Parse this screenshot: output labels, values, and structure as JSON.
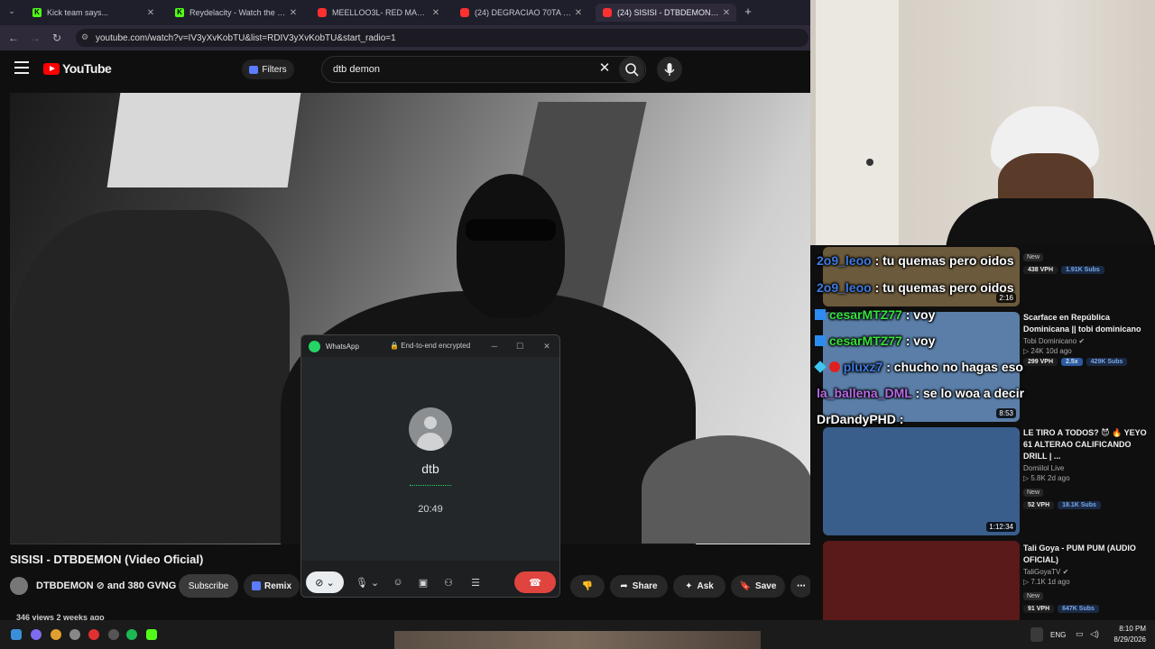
{
  "browser": {
    "tabs": [
      {
        "title": "Kick team says...",
        "favicon": "kick-icon"
      },
      {
        "title": "Reydelacity - Watch the VOD o",
        "favicon": "kick-icon"
      },
      {
        "title": "MEELLOO3L- RED MALA (VIDE",
        "favicon": "youtube-icon"
      },
      {
        "title": "(24) DEGRACIAO 70TA - YouTu",
        "favicon": "youtube-icon"
      },
      {
        "title": "(24) SISISI - DTBDEMON (Vide",
        "favicon": "youtube-icon"
      }
    ],
    "url": "youtube.com/watch?v=IV3yXvKobTU&list=RDIV3yXvKobTU&start_radio=1"
  },
  "youtube": {
    "logo": "YouTube",
    "filters_label": "Filters",
    "search_value": "dtb demon"
  },
  "video": {
    "title": "SISISI - DTBDEMON (Video Oficial)",
    "channel": "DTBDEMON ⊘ and 380 GVNG",
    "subscribe_label": "Subscribe",
    "remix_label": "Remix",
    "share_label": "Share",
    "ask_label": "Ask",
    "save_label": "Save",
    "views": "346 views  2 weeks ago"
  },
  "whatsapp": {
    "app_name": "WhatsApp",
    "encryption": "End-to-end encrypted",
    "contact": "dtb",
    "timer": "20:49"
  },
  "recommendations": [
    {
      "title": "",
      "channel": "",
      "meta": "",
      "badge": "New",
      "duration": "2:16",
      "vph": "438 VPH",
      "multiplier": "",
      "subs": "1.91K Subs",
      "thumb": "#6b5a3c"
    },
    {
      "title": "Scarface en República Dominicana || tobi dominicano",
      "channel": "Tobi Dominicano ✔",
      "meta": "▷ 24K  10d ago",
      "badge": "",
      "duration": "8:53",
      "vph": "299 VPH",
      "multiplier": "2.5x",
      "subs": "429K Subs",
      "thumb": "#5a7ea8"
    },
    {
      "title": "LE TIRO A TODOS? 😈 🔥 YEYO 61 ALTERAO CALIFICANDO DRILL | ...",
      "channel": "Domiilol Live",
      "meta": "▷ 5.8K  2d ago",
      "badge": "New",
      "duration": "1:12:34",
      "vph": "52 VPH",
      "multiplier": "",
      "subs": "18.1K Subs",
      "thumb": "#3a5e8c"
    },
    {
      "title": "Tali Goya - PUM PUM (AUDIO OFICIAL)",
      "channel": "TaliGoyaTV ✔",
      "meta": "▷ 7.1K  1d ago",
      "badge": "New",
      "duration": "",
      "vph": "91 VPH",
      "multiplier": "",
      "subs": "647K Subs",
      "thumb": "#5a1a1a"
    }
  ],
  "chat": [
    {
      "user": "2o9_leoo",
      "message": ": tu quemas pero oidos",
      "color": "#3d7be0",
      "badge": ""
    },
    {
      "user": "2o9_leoo",
      "message": ": tu quemas pero oidos",
      "color": "#3d7be0",
      "badge": ""
    },
    {
      "user": "cesarMTZ77",
      "message": ": voy",
      "color": "#36e03c",
      "badge": "flag"
    },
    {
      "user": "cesarMTZ77",
      "message": ": voy",
      "color": "#36e03c",
      "badge": "flag"
    },
    {
      "user": "pluxz7",
      "message": ": chucho no hagas eso",
      "color": "#3d7be0",
      "badge": "gem"
    },
    {
      "user": "la_ballena_DML",
      "message": ": se lo woa a decir",
      "color": "#b86be8",
      "badge": ""
    },
    {
      "user": "DrDandyPHD",
      "message": ":",
      "color": "#ffffff",
      "badge": ""
    }
  ],
  "taskbar": {
    "lang": "ENG",
    "time": "8:10 PM",
    "date": "8/29/2026"
  }
}
